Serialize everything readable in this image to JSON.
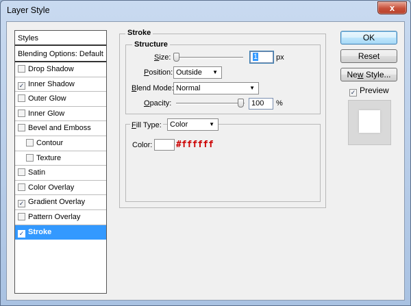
{
  "window": {
    "title": "Layer Style",
    "close_glyph": "x"
  },
  "styles_panel": {
    "header": "Styles",
    "blending": "Blending Options: Default",
    "items": [
      {
        "label": "Drop Shadow",
        "checked": false,
        "sub": false,
        "selected": false
      },
      {
        "label": "Inner Shadow",
        "checked": true,
        "sub": false,
        "selected": false
      },
      {
        "label": "Outer Glow",
        "checked": false,
        "sub": false,
        "selected": false
      },
      {
        "label": "Inner Glow",
        "checked": false,
        "sub": false,
        "selected": false
      },
      {
        "label": "Bevel and Emboss",
        "checked": false,
        "sub": false,
        "selected": false
      },
      {
        "label": "Contour",
        "checked": false,
        "sub": true,
        "selected": false
      },
      {
        "label": "Texture",
        "checked": false,
        "sub": true,
        "selected": false
      },
      {
        "label": "Satin",
        "checked": false,
        "sub": false,
        "selected": false
      },
      {
        "label": "Color Overlay",
        "checked": false,
        "sub": false,
        "selected": false
      },
      {
        "label": "Gradient Overlay",
        "checked": true,
        "sub": false,
        "selected": false
      },
      {
        "label": "Pattern Overlay",
        "checked": false,
        "sub": false,
        "selected": false
      },
      {
        "label": "Stroke",
        "checked": true,
        "sub": false,
        "selected": true
      }
    ]
  },
  "stroke": {
    "title": "Stroke",
    "structure": {
      "title": "Structure",
      "size_label_u": "S",
      "size_label_rest": "ize:",
      "size_value": "1",
      "size_unit": "px",
      "position_label_u": "P",
      "position_label_rest": "osition:",
      "position_value": "Outside",
      "blend_label_u": "B",
      "blend_label_rest": "lend Mode:",
      "blend_value": "Normal",
      "opacity_label_u": "O",
      "opacity_label_rest": "pacity:",
      "opacity_value": "100",
      "opacity_unit": "%"
    },
    "fill": {
      "label_u": "F",
      "label_rest": "ill Type:",
      "type_value": "Color",
      "color_label": "Color:",
      "color_hex": "#ffffff"
    }
  },
  "buttons": {
    "ok": "OK",
    "reset": "Reset",
    "new_style_u": "w",
    "new_style_pre": "Ne",
    "new_style_post": " Style...",
    "preview_label": "Preview",
    "preview_checked": true
  },
  "colors": {
    "selection": "#3399ff",
    "hex_text": "#cc0000"
  }
}
